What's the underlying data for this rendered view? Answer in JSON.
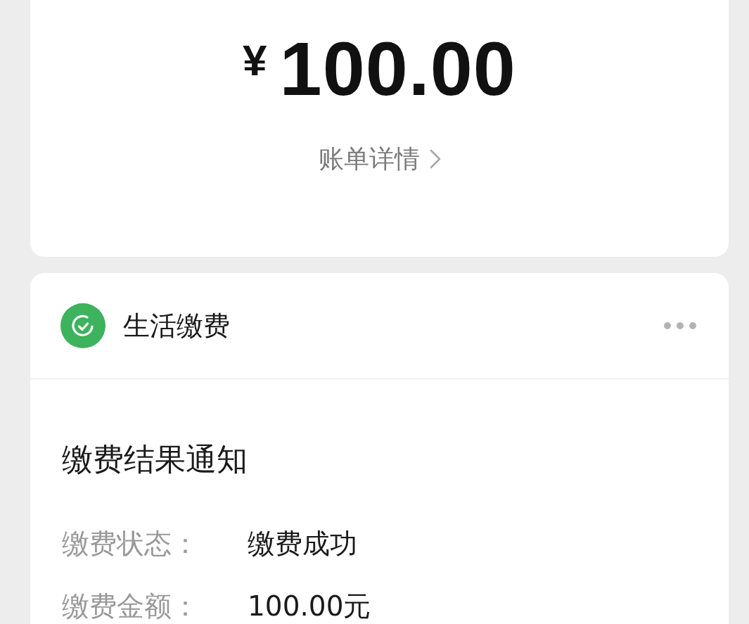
{
  "amount_card": {
    "currency": "¥",
    "amount": "100.00",
    "details_link": "账单详情"
  },
  "service_card": {
    "service_name": "生活缴费",
    "notice_title": "缴费结果通知",
    "fields": [
      {
        "label": "缴费状态：",
        "value": "缴费成功"
      },
      {
        "label": "缴费金额：",
        "value": "100.00元"
      }
    ]
  }
}
